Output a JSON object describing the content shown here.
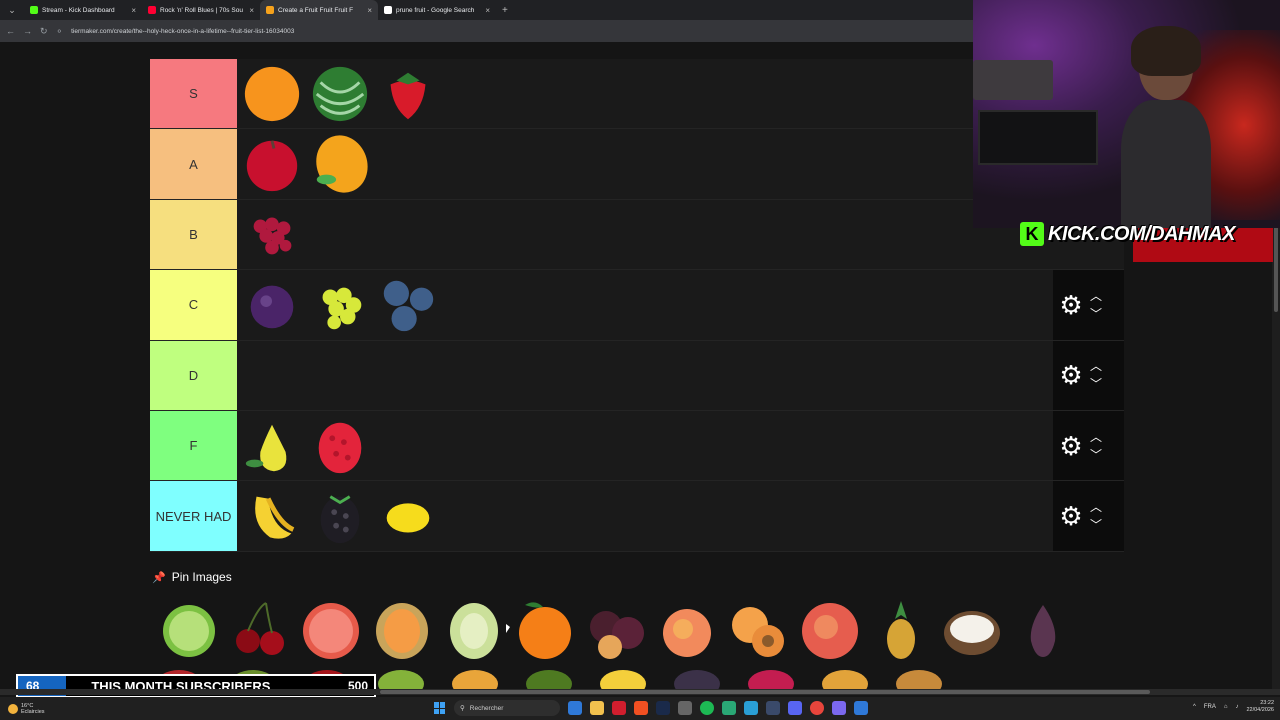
{
  "browser": {
    "tabs": [
      {
        "title": "Stream - Kick Dashboard",
        "favicon_color": "#53fc18",
        "active": false
      },
      {
        "title": "Rock 'n' Roll Blues | 70s Sou",
        "favicon_color": "#ff0033",
        "active": false
      },
      {
        "title": "Create a Fruit Fruit Fruit F",
        "favicon_color": "#f6a21c",
        "active": true
      },
      {
        "title": "prune fruit - Google Search",
        "favicon_color": "#ffffff",
        "active": false
      }
    ],
    "close_glyph": "×",
    "new_tab_glyph": "+",
    "url": "tiermaker.com/create/the--holy-heck-once-in-a-lifetime--fruit-tier-list-16034003"
  },
  "tiers": [
    {
      "label": "S",
      "color": "#f6797f",
      "items": [
        "orange",
        "watermelon",
        "strawberry"
      ]
    },
    {
      "label": "A",
      "color": "#f6bf7f",
      "items": [
        "red-apple",
        "mango"
      ]
    },
    {
      "label": "B",
      "color": "#f6df7f",
      "items": [
        "red-grapes"
      ]
    },
    {
      "label": "C",
      "color": "#f6ff7f",
      "items": [
        "plum",
        "green-grapes",
        "blueberries"
      ]
    },
    {
      "label": "D",
      "color": "#bfff7f",
      "items": []
    },
    {
      "label": "F",
      "color": "#7fff7f",
      "items": [
        "pear",
        "raspberry"
      ]
    },
    {
      "label": "NEVER HAD",
      "color": "#7fffff",
      "items": [
        "banana",
        "blackberry",
        "lemon"
      ]
    }
  ],
  "pin_images": {
    "label": "Pin Images",
    "items": [
      "lime",
      "cherries",
      "grapefruit",
      "cantaloupe",
      "honeydew",
      "clementine",
      "plums",
      "peach",
      "apricot",
      "nectarine",
      "pineapple",
      "coconut",
      "fig"
    ]
  },
  "overlay": {
    "kick_logo_letter": "K",
    "kick_url": "KICK.COM/DAHMAX",
    "subscribers": {
      "current": "68",
      "label": "THIS MONTH SUBSCRIBERS",
      "goal": "500",
      "progress_fraction": 0.136
    }
  },
  "taskbar": {
    "weather_temp": "16°C",
    "weather_desc": "Eclaircies",
    "search_placeholder": "Rechercher",
    "language": "FRA",
    "time": "23:22",
    "date": "22/04/2026"
  },
  "icons": {
    "gear": "⚙",
    "arrow_up": "︿",
    "arrow_down": "﹀",
    "pin": "📌",
    "back": "←",
    "forward": "→",
    "reload": "↻"
  }
}
